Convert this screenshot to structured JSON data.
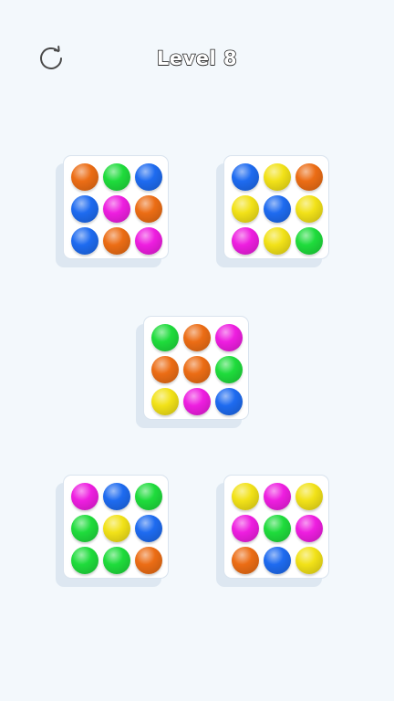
{
  "header": {
    "level_label": "Level 8",
    "restart_icon": "restart-icon"
  },
  "colors": {
    "background": "#f3f8fc",
    "orange": "#ec6d15",
    "green": "#1fdc3c",
    "blue": "#1e6bf0",
    "magenta": "#ee1ee0",
    "yellow": "#f2e218"
  },
  "trays": [
    {
      "name": "tray-top-left",
      "balls": [
        "orange",
        "green",
        "blue",
        "blue",
        "magenta",
        "orange",
        "blue",
        "orange",
        "magenta"
      ]
    },
    {
      "name": "tray-top-right",
      "balls": [
        "blue",
        "yellow",
        "orange",
        "yellow",
        "blue",
        "yellow",
        "magenta",
        "yellow",
        "green"
      ]
    },
    {
      "name": "tray-center",
      "balls": [
        "green",
        "orange",
        "magenta",
        "orange",
        "orange",
        "green",
        "yellow",
        "magenta",
        "blue"
      ]
    },
    {
      "name": "tray-bottom-left",
      "balls": [
        "magenta",
        "blue",
        "green",
        "green",
        "yellow",
        "blue",
        "green",
        "green",
        "orange"
      ]
    },
    {
      "name": "tray-bottom-right",
      "balls": [
        "yellow",
        "magenta",
        "yellow",
        "magenta",
        "green",
        "magenta",
        "orange",
        "blue",
        "yellow"
      ]
    }
  ]
}
